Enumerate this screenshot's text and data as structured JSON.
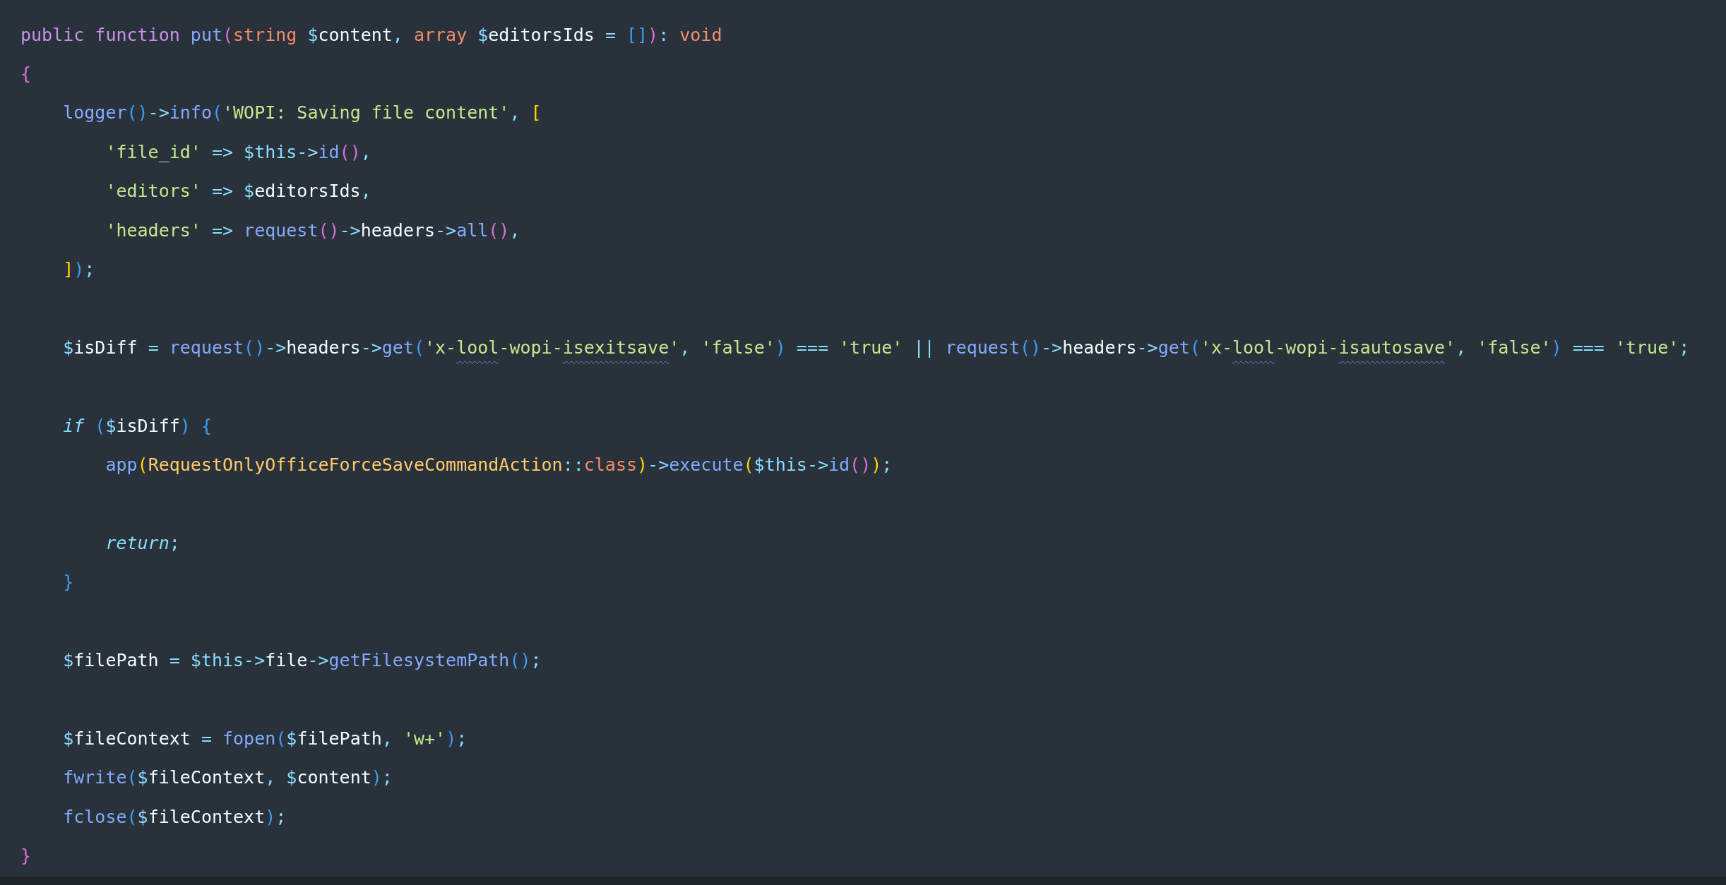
{
  "blocks": [
    {
      "lines": [
        {
          "tokens": [
            {
              "text": "public ",
              "kind": "keyword"
            },
            {
              "text": "function ",
              "kind": "keyword"
            },
            {
              "text": "put",
              "kind": "function"
            },
            {
              "text": "(",
              "kind": "bracket-pink"
            },
            {
              "text": "string ",
              "kind": "type"
            },
            {
              "text": "$",
              "kind": "sigil"
            },
            {
              "text": "content",
              "kind": "name"
            },
            {
              "text": ", ",
              "kind": "operator"
            },
            {
              "text": "array ",
              "kind": "type"
            },
            {
              "text": "$",
              "kind": "sigil"
            },
            {
              "text": "editorsIds",
              "kind": "name"
            },
            {
              "text": " = ",
              "kind": "operator"
            },
            {
              "text": "[]",
              "kind": "bracket-blue"
            },
            {
              "text": ")",
              "kind": "bracket-pink"
            },
            {
              "text": ": ",
              "kind": "operator"
            },
            {
              "text": "void",
              "kind": "type"
            }
          ]
        },
        {
          "tokens": [
            {
              "text": "{",
              "kind": "bracket-pink"
            }
          ]
        },
        {
          "tokens": [
            {
              "text": "    logger",
              "kind": "function"
            },
            {
              "text": "()",
              "kind": "bracket-blue"
            },
            {
              "text": "->",
              "kind": "operator"
            },
            {
              "text": "info",
              "kind": "function"
            },
            {
              "text": "(",
              "kind": "bracket-blue"
            },
            {
              "text": "'WOPI: Saving file content'",
              "kind": "string"
            },
            {
              "text": ", ",
              "kind": "operator"
            },
            {
              "text": "[",
              "kind": "bracket-yellow"
            }
          ]
        },
        {
          "tokens": [
            {
              "text": "        'file_id'",
              "kind": "string"
            },
            {
              "text": " => ",
              "kind": "operator"
            },
            {
              "text": "$this",
              "kind": "sigil"
            },
            {
              "text": "->",
              "kind": "operator"
            },
            {
              "text": "id",
              "kind": "function"
            },
            {
              "text": "()",
              "kind": "bracket-pink"
            },
            {
              "text": ",",
              "kind": "operator"
            }
          ]
        },
        {
          "tokens": [
            {
              "text": "        'editors'",
              "kind": "string"
            },
            {
              "text": " => ",
              "kind": "operator"
            },
            {
              "text": "$",
              "kind": "sigil"
            },
            {
              "text": "editorsIds",
              "kind": "name"
            },
            {
              "text": ",",
              "kind": "operator"
            }
          ]
        },
        {
          "tokens": [
            {
              "text": "        'headers'",
              "kind": "string"
            },
            {
              "text": " => ",
              "kind": "operator"
            },
            {
              "text": "request",
              "kind": "function"
            },
            {
              "text": "()",
              "kind": "bracket-pink"
            },
            {
              "text": "->",
              "kind": "operator"
            },
            {
              "text": "headers",
              "kind": "name"
            },
            {
              "text": "->",
              "kind": "operator"
            },
            {
              "text": "all",
              "kind": "function"
            },
            {
              "text": "()",
              "kind": "bracket-pink"
            },
            {
              "text": ",",
              "kind": "operator"
            }
          ]
        },
        {
          "tokens": [
            {
              "text": "    ]",
              "kind": "bracket-yellow"
            },
            {
              "text": ")",
              "kind": "bracket-blue"
            },
            {
              "text": ";",
              "kind": "operator"
            }
          ]
        }
      ]
    },
    {
      "lines": [
        {
          "tokens": [
            {
              "text": "    $",
              "kind": "sigil"
            },
            {
              "text": "isDiff",
              "kind": "name"
            },
            {
              "text": " = ",
              "kind": "operator"
            },
            {
              "text": "request",
              "kind": "function"
            },
            {
              "text": "()",
              "kind": "bracket-blue"
            },
            {
              "text": "->",
              "kind": "operator"
            },
            {
              "text": "headers",
              "kind": "name"
            },
            {
              "text": "->",
              "kind": "operator"
            },
            {
              "text": "get",
              "kind": "function"
            },
            {
              "text": "(",
              "kind": "bracket-blue"
            },
            {
              "text": "'x-",
              "kind": "string"
            },
            {
              "text": "lool",
              "kind": "string",
              "misspelled": true
            },
            {
              "text": "-wopi-",
              "kind": "string"
            },
            {
              "text": "isexitsave",
              "kind": "string",
              "misspelled": true
            },
            {
              "text": "'",
              "kind": "string"
            },
            {
              "text": ", ",
              "kind": "operator"
            },
            {
              "text": "'false'",
              "kind": "string"
            },
            {
              "text": ")",
              "kind": "bracket-blue"
            },
            {
              "text": " === ",
              "kind": "operator"
            },
            {
              "text": "'true'",
              "kind": "string"
            },
            {
              "text": " || ",
              "kind": "operator"
            },
            {
              "text": "request",
              "kind": "function"
            },
            {
              "text": "()",
              "kind": "bracket-blue"
            },
            {
              "text": "->",
              "kind": "operator"
            },
            {
              "text": "headers",
              "kind": "name"
            },
            {
              "text": "->",
              "kind": "operator"
            },
            {
              "text": "get",
              "kind": "function"
            },
            {
              "text": "(",
              "kind": "bracket-blue"
            },
            {
              "text": "'x-",
              "kind": "string"
            },
            {
              "text": "lool",
              "kind": "string",
              "misspelled": true
            },
            {
              "text": "-wopi-",
              "kind": "string"
            },
            {
              "text": "isautosave",
              "kind": "string",
              "misspelled": true
            },
            {
              "text": "'",
              "kind": "string"
            },
            {
              "text": ", ",
              "kind": "operator"
            },
            {
              "text": "'false'",
              "kind": "string"
            },
            {
              "text": ")",
              "kind": "bracket-blue"
            },
            {
              "text": " === ",
              "kind": "operator"
            },
            {
              "text": "'true'",
              "kind": "string"
            },
            {
              "text": ";",
              "kind": "operator"
            }
          ]
        }
      ]
    },
    {
      "lines": [
        {
          "tokens": [
            {
              "text": "    if ",
              "kind": "control"
            },
            {
              "text": "(",
              "kind": "bracket-blue"
            },
            {
              "text": "$",
              "kind": "sigil"
            },
            {
              "text": "isDiff",
              "kind": "name"
            },
            {
              "text": ") {",
              "kind": "bracket-blue"
            }
          ]
        },
        {
          "tokens": [
            {
              "text": "        app",
              "kind": "function"
            },
            {
              "text": "(",
              "kind": "bracket-yellow"
            },
            {
              "text": "RequestOnlyOfficeForceSaveCommandAction",
              "kind": "class"
            },
            {
              "text": "::",
              "kind": "operator"
            },
            {
              "text": "class",
              "kind": "type"
            },
            {
              "text": ")",
              "kind": "bracket-yellow"
            },
            {
              "text": "->",
              "kind": "operator"
            },
            {
              "text": "execute",
              "kind": "function"
            },
            {
              "text": "(",
              "kind": "bracket-yellow"
            },
            {
              "text": "$this",
              "kind": "sigil"
            },
            {
              "text": "->",
              "kind": "operator"
            },
            {
              "text": "id",
              "kind": "function"
            },
            {
              "text": "()",
              "kind": "bracket-pink"
            },
            {
              "text": ")",
              "kind": "bracket-yellow"
            },
            {
              "text": ";",
              "kind": "operator"
            }
          ]
        }
      ]
    },
    {
      "lines": [
        {
          "tokens": [
            {
              "text": "        return",
              "kind": "control"
            },
            {
              "text": ";",
              "kind": "operator"
            }
          ]
        },
        {
          "tokens": [
            {
              "text": "    }",
              "kind": "bracket-blue"
            }
          ]
        }
      ]
    },
    {
      "lines": [
        {
          "tokens": [
            {
              "text": "    $",
              "kind": "sigil"
            },
            {
              "text": "filePath",
              "kind": "name"
            },
            {
              "text": " = ",
              "kind": "operator"
            },
            {
              "text": "$this",
              "kind": "sigil"
            },
            {
              "text": "->",
              "kind": "operator"
            },
            {
              "text": "file",
              "kind": "name"
            },
            {
              "text": "->",
              "kind": "operator"
            },
            {
              "text": "getFilesystemPath",
              "kind": "function"
            },
            {
              "text": "()",
              "kind": "bracket-blue"
            },
            {
              "text": ";",
              "kind": "operator"
            }
          ]
        }
      ]
    },
    {
      "lines": [
        {
          "tokens": [
            {
              "text": "    $",
              "kind": "sigil"
            },
            {
              "text": "fileContext",
              "kind": "name"
            },
            {
              "text": " = ",
              "kind": "operator"
            },
            {
              "text": "fopen",
              "kind": "function"
            },
            {
              "text": "(",
              "kind": "bracket-blue"
            },
            {
              "text": "$",
              "kind": "sigil"
            },
            {
              "text": "filePath",
              "kind": "name"
            },
            {
              "text": ", ",
              "kind": "operator"
            },
            {
              "text": "'w+'",
              "kind": "string"
            },
            {
              "text": ")",
              "kind": "bracket-blue"
            },
            {
              "text": ";",
              "kind": "operator"
            }
          ]
        },
        {
          "tokens": [
            {
              "text": "    fwrite",
              "kind": "function"
            },
            {
              "text": "(",
              "kind": "bracket-blue"
            },
            {
              "text": "$",
              "kind": "sigil"
            },
            {
              "text": "fileContext",
              "kind": "name"
            },
            {
              "text": ", ",
              "kind": "operator"
            },
            {
              "text": "$",
              "kind": "sigil"
            },
            {
              "text": "content",
              "kind": "name"
            },
            {
              "text": ")",
              "kind": "bracket-blue"
            },
            {
              "text": ";",
              "kind": "operator"
            }
          ]
        },
        {
          "tokens": [
            {
              "text": "    fclose",
              "kind": "function"
            },
            {
              "text": "(",
              "kind": "bracket-blue"
            },
            {
              "text": "$",
              "kind": "sigil"
            },
            {
              "text": "fileContext",
              "kind": "name"
            },
            {
              "text": ")",
              "kind": "bracket-blue"
            },
            {
              "text": ";",
              "kind": "operator"
            }
          ]
        },
        {
          "tokens": [
            {
              "text": "}",
              "kind": "bracket-pink"
            }
          ]
        }
      ]
    }
  ]
}
